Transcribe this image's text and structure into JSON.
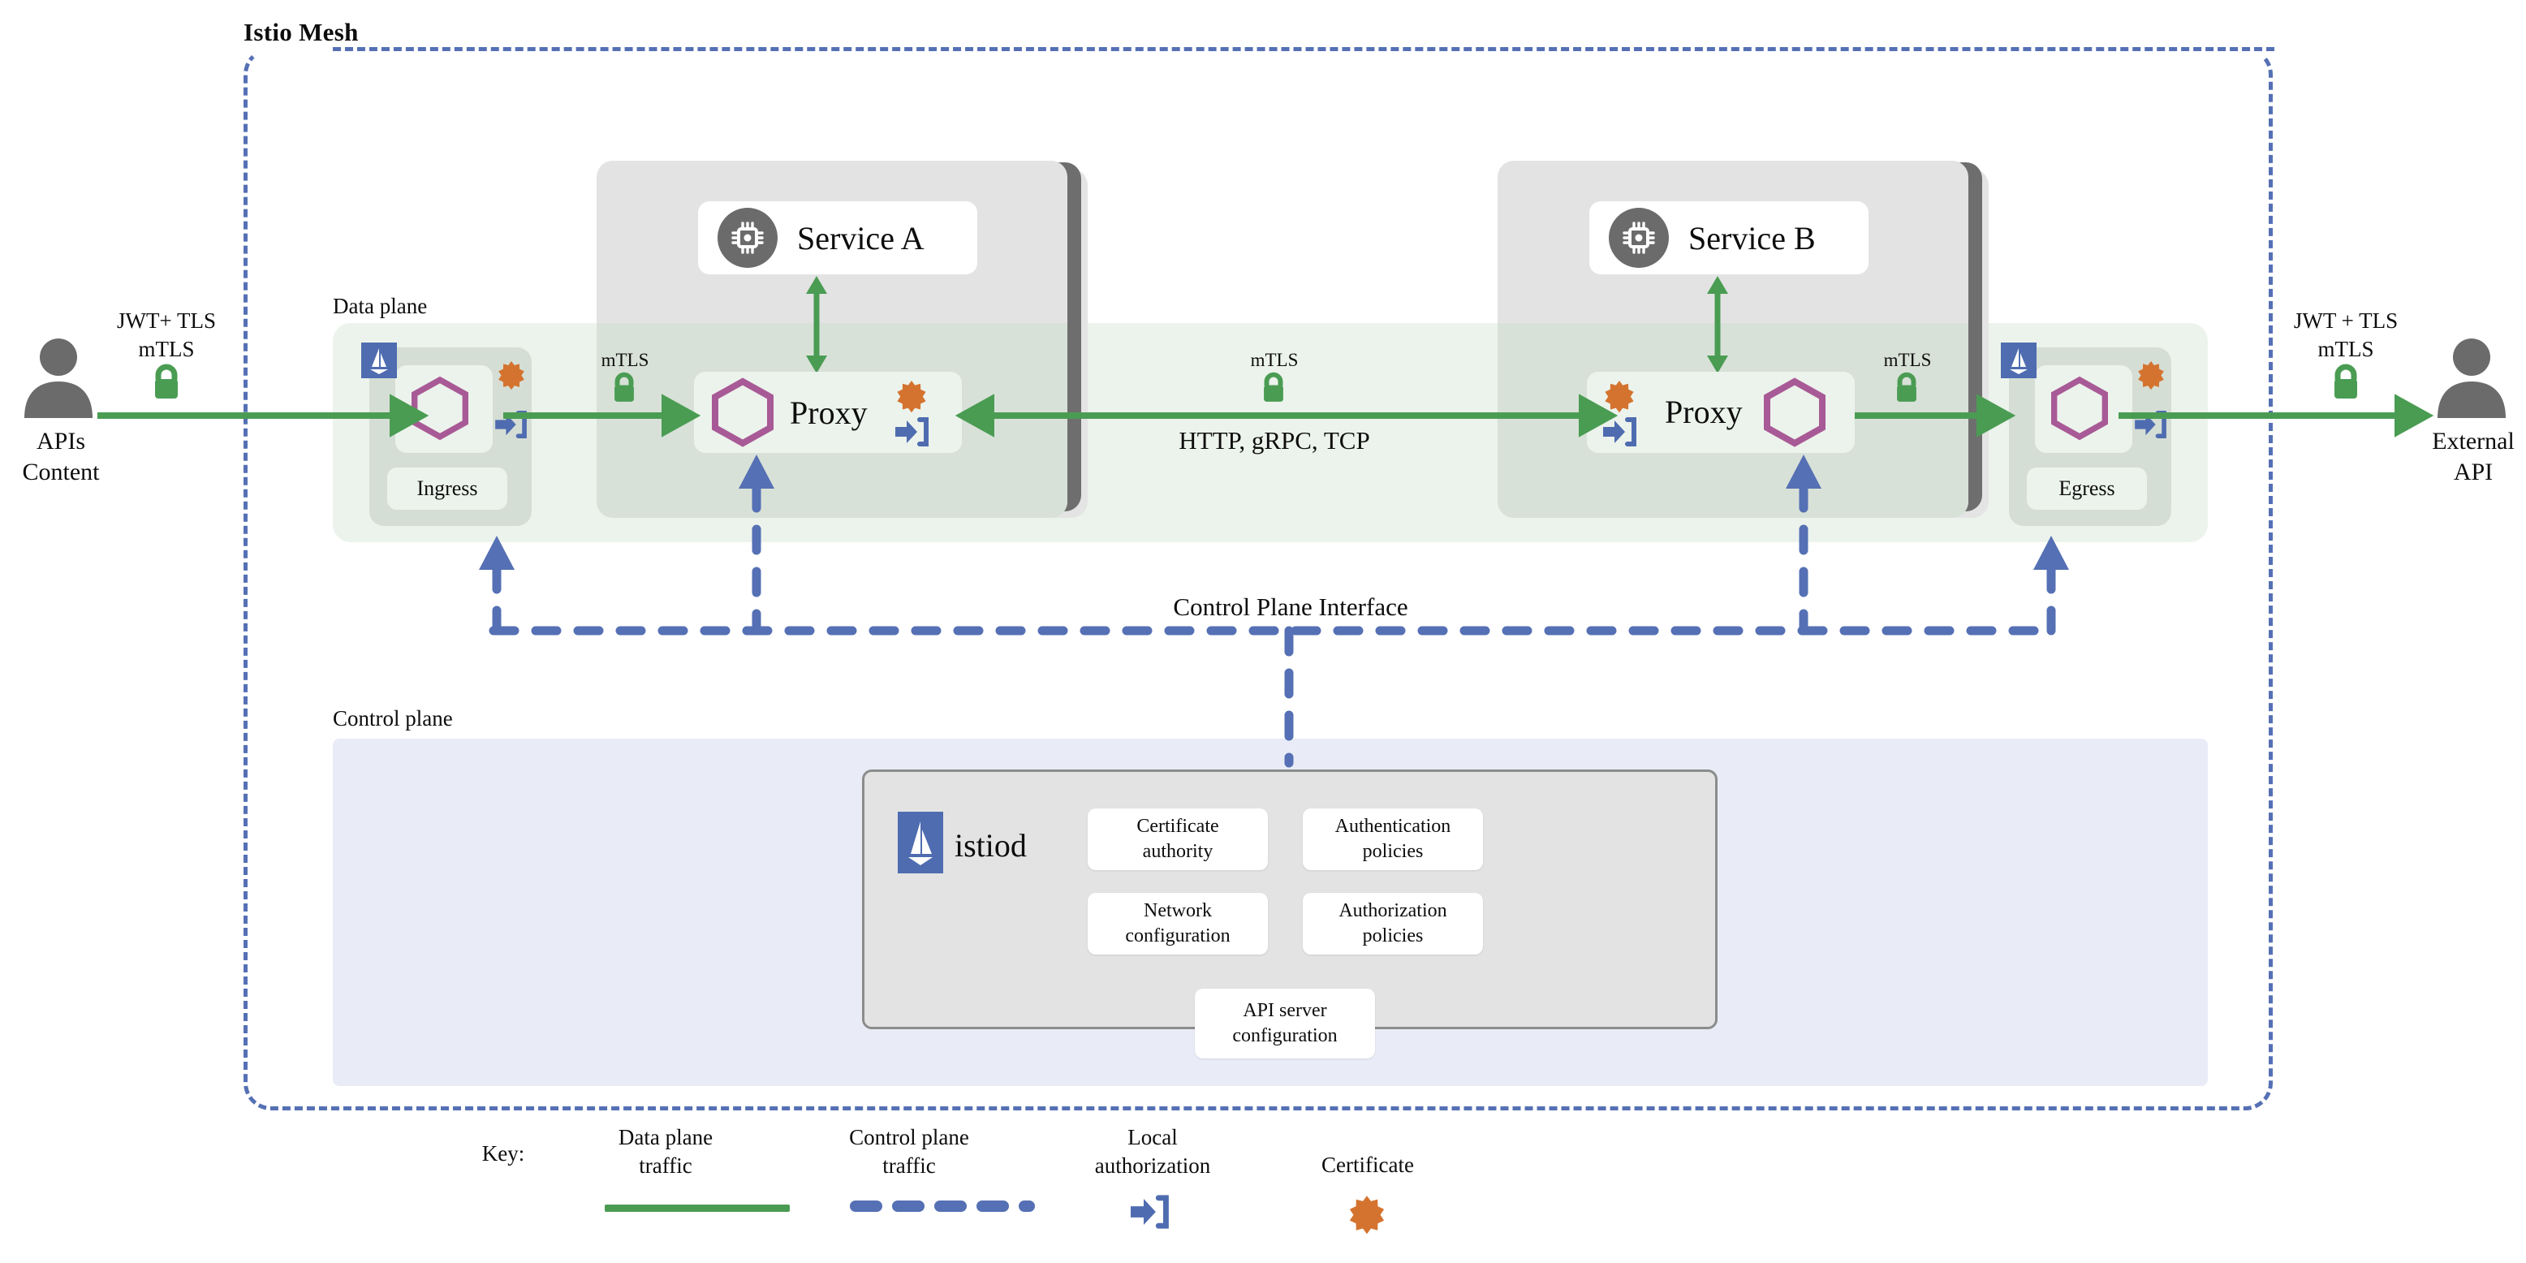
{
  "mesh": {
    "title": "Istio Mesh"
  },
  "planes": {
    "data_label": "Data plane",
    "control_label": "Control plane",
    "interface_label": "Control Plane Interface"
  },
  "endpoints": {
    "left": {
      "name": "APIs\nContent",
      "name_line1": "APIs",
      "name_line2": "Content",
      "protocol_line1": "JWT+ TLS",
      "protocol_line2": "mTLS",
      "lock_icon": "lock-icon"
    },
    "right": {
      "name_line1": "External",
      "name_line2": "API",
      "protocol_line1": "JWT + TLS",
      "protocol_line2": "mTLS",
      "lock_icon": "lock-icon"
    }
  },
  "gateways": {
    "ingress": {
      "label": "Ingress",
      "logo": "istio-sail-icon",
      "proxy_icon": "hexagon-icon",
      "cert_icon": "certificate-icon",
      "authz_icon": "local-authorization-icon"
    },
    "egress": {
      "label": "Egress",
      "logo": "istio-sail-icon",
      "proxy_icon": "hexagon-icon",
      "cert_icon": "certificate-icon",
      "authz_icon": "local-authorization-icon"
    }
  },
  "services": [
    {
      "name": "Service A",
      "icon": "chip-icon",
      "proxy_label": "Proxy",
      "mtls_label": "mTLS"
    },
    {
      "name": "Service B",
      "icon": "chip-icon",
      "proxy_label": "Proxy",
      "mtls_label": "mTLS"
    }
  ],
  "links": {
    "mtls_ingress_to_a": "mTLS",
    "mtls_a_to_b": "mTLS",
    "mtls_b_to_egress": "mTLS",
    "protocols": "HTTP, gRPC, TCP"
  },
  "istiod": {
    "name": "istiod",
    "logo": "istio-sail-icon",
    "components": [
      {
        "line1": "Certificate",
        "line2": "authority"
      },
      {
        "line1": "Authentication",
        "line2": "policies"
      },
      {
        "line1": "Network",
        "line2": "configuration"
      },
      {
        "line1": "Authorization",
        "line2": "policies"
      }
    ],
    "api_server": {
      "line1": "API server",
      "line2": "configuration"
    }
  },
  "legend": {
    "title": "Key:",
    "items": [
      {
        "line1": "Data plane",
        "line2": "traffic",
        "icon": "green-line-icon"
      },
      {
        "line1": "Control plane",
        "line2": "traffic",
        "icon": "blue-dashed-line-icon"
      },
      {
        "line1": "Local",
        "line2": "authorization",
        "icon": "local-authorization-icon"
      },
      {
        "line1": "Certificate",
        "line2": "",
        "icon": "certificate-icon"
      }
    ]
  },
  "colors": {
    "green_traffic": "#4a9c53",
    "blue_control": "#5570b4",
    "istio_blue": "#4f6cb0",
    "certificate_orange": "#d4732f",
    "hexagon_purple": "#a85a96",
    "service_gray": "#6b6b6b",
    "data_plane_bg": "#ecf3ec",
    "control_plane_bg": "#e9ecf7"
  }
}
